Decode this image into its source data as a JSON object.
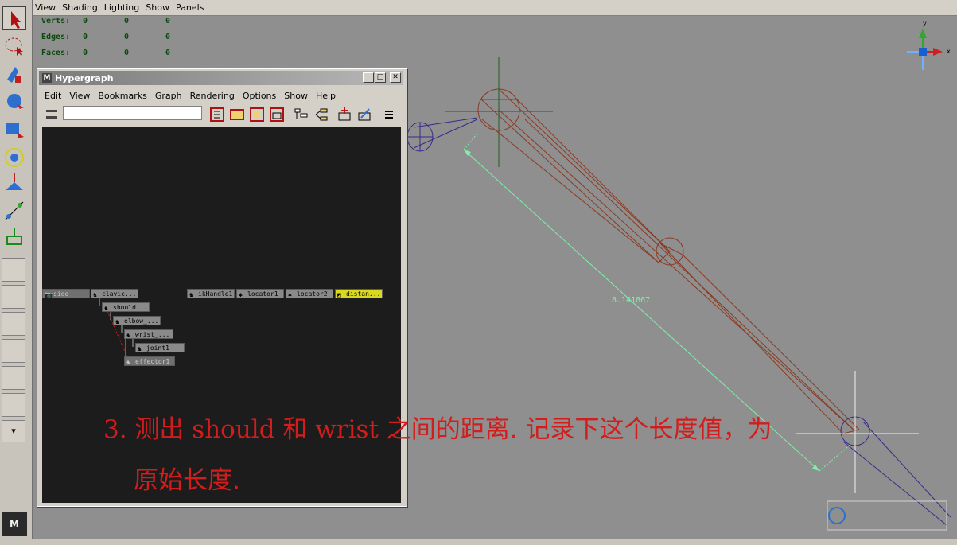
{
  "menubar": {
    "items": [
      "View",
      "Shading",
      "Lighting",
      "Show",
      "Panels"
    ]
  },
  "hud": {
    "rows": [
      {
        "label": "Verts:",
        "values": [
          "0",
          "0",
          "0"
        ]
      },
      {
        "label": "Edges:",
        "values": [
          "0",
          "0",
          "0"
        ]
      },
      {
        "label": "Faces:",
        "values": [
          "0",
          "0",
          "0"
        ]
      }
    ]
  },
  "hypergraph": {
    "title": "Hypergraph",
    "menu": [
      "Edit",
      "View",
      "Bookmarks",
      "Graph",
      "Rendering",
      "Options",
      "Show",
      "Help"
    ],
    "search_value": "",
    "nodes": {
      "side": "side",
      "clavicle": "clavic...",
      "shoulder": "should...",
      "elbow": "elbow_...",
      "wrist": "wrist_...",
      "joint1": "joint1",
      "effector1": "effector1",
      "ikhandle": "ikHandle1",
      "locator1": "locator1",
      "locator2": "locator2",
      "distance": "distan..."
    }
  },
  "viewport": {
    "distance_label": "8.141867",
    "axes": {
      "y": "y",
      "x": "x"
    }
  },
  "annotation": {
    "line1": "3. 测出 should  和 wrist 之间的距离. 记录下这个长度值，为",
    "line2": "原始长度."
  },
  "colors": {
    "annotation": "#d31c1c",
    "distance": "#7ef0a8",
    "hud": "#0d4a0d",
    "bone": "#8a3a22",
    "ik": "#3a2a8a",
    "selected_node": "#d8d820"
  }
}
